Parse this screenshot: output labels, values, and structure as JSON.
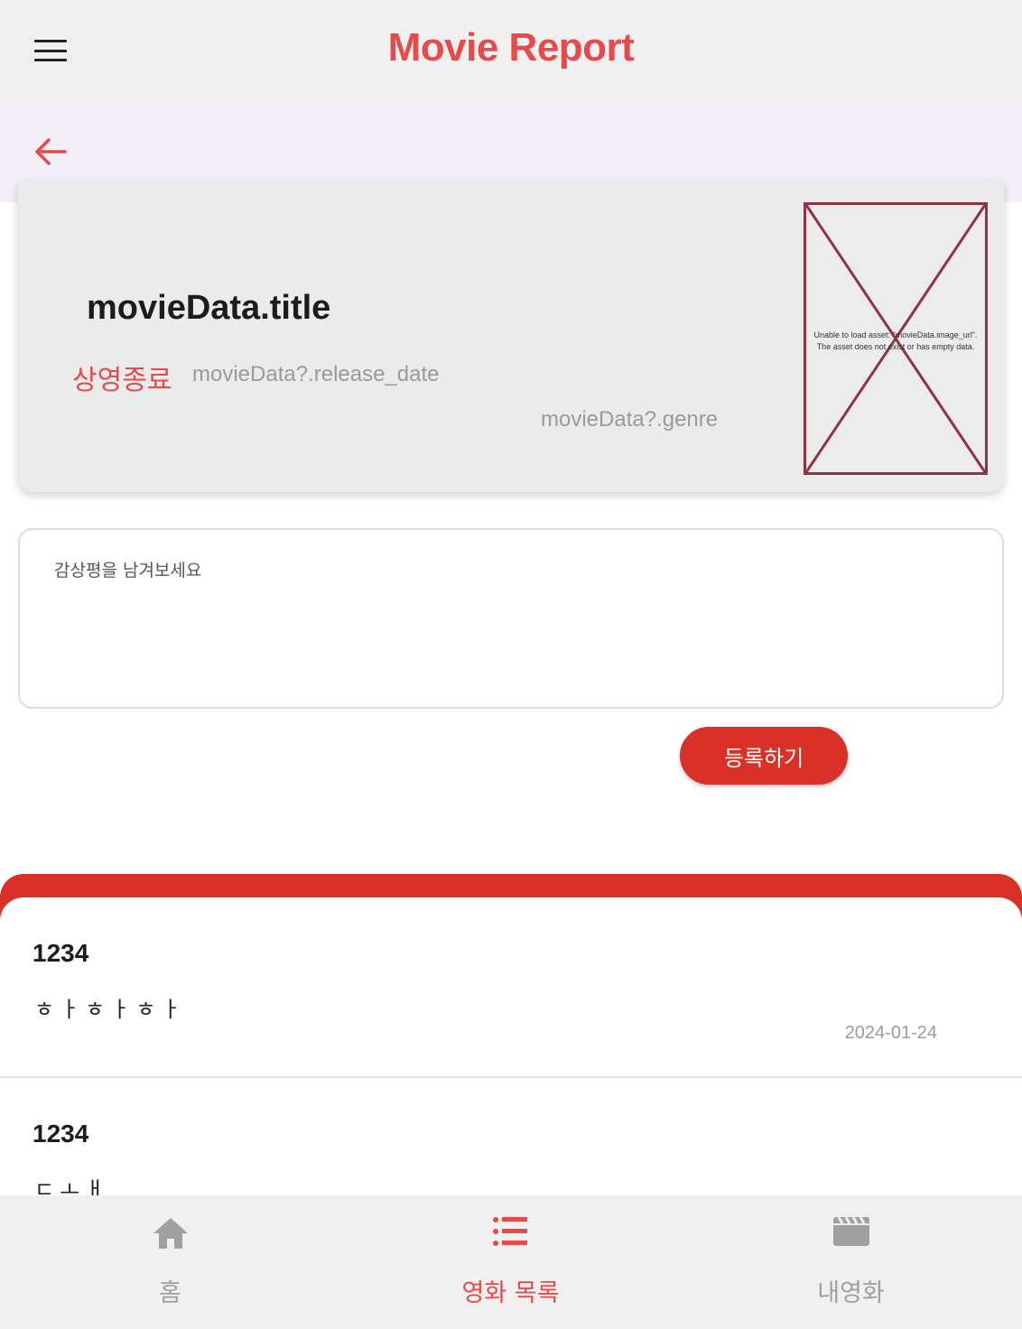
{
  "app_bar": {
    "title": "Movie Report",
    "menu_icon": "hamburger-menu-icon"
  },
  "sub_bar": {
    "back_icon": "arrow-left-icon"
  },
  "movie": {
    "title": "movieData.title",
    "status": "상영종료",
    "release_date": "movieData?.release_date",
    "genre": "movieData?.genre",
    "poster_error": "Unable to load asset: \"movieData.image_url\". The asset does not exist or has empty data."
  },
  "review_form": {
    "placeholder": "감상평을 남겨보세요",
    "value": "",
    "submit_label": "등록하기"
  },
  "reviews": [
    {
      "author": "1234",
      "text": "ㅎㅏㅎㅏㅎㅏ",
      "date": "2024-01-24"
    },
    {
      "author": "1234",
      "text": "ㄷㅗㅐ",
      "date": ""
    }
  ],
  "bottom_nav": [
    {
      "label": "홈",
      "icon": "home-icon",
      "active": false
    },
    {
      "label": "영화 목록",
      "icon": "list-icon",
      "active": true
    },
    {
      "label": "내영화",
      "icon": "movie-clapper-icon",
      "active": false
    }
  ],
  "colors": {
    "accent": "#e64a4a",
    "button": "#d93127",
    "poster_border": "#8c3445"
  }
}
